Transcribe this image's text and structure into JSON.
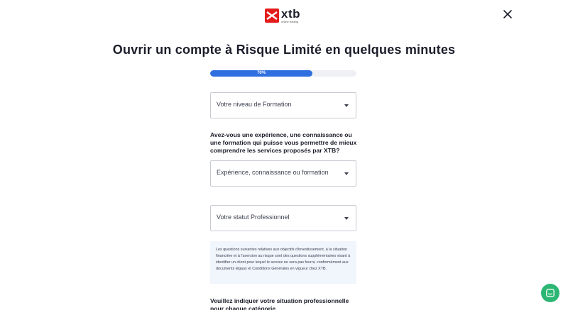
{
  "header": {
    "brand": "xtb",
    "tagline": "online trading",
    "brand_color": "#e31d1a"
  },
  "title": "Ouvrir un compte à Risque Limité en quelques minutes",
  "progress": {
    "label": "70%",
    "value": 0.7,
    "color": "#2f6fe0"
  },
  "form": {
    "education_select": "Votre niveau de Formation",
    "experience_question": "Avez-vous une expérience, une connaissance ou une formation qui puisse vous permettre de mieux comprendre les services proposés par XTB?",
    "experience_select": "Expérience, connaissance ou formation",
    "status_select": "Votre statut Professionnel",
    "info_text": "Les questions suivantes relatives aux objectifs d'investissement, à la situation financière et à l'aversion au risque sont des questions supplémentaires visant à identifier un client pour lequel le service ne sera pas fourni, conformément aux documents légaux et Conditions Générales en vigueur chez XTB.",
    "situation_question": "Veuillez indiquer votre situation professionnelle pour chaque catégorie"
  },
  "icons": {
    "close": "close-icon",
    "chat": "chat-icon",
    "caret": "caret-down-icon"
  },
  "chat_color": "#2bb673"
}
